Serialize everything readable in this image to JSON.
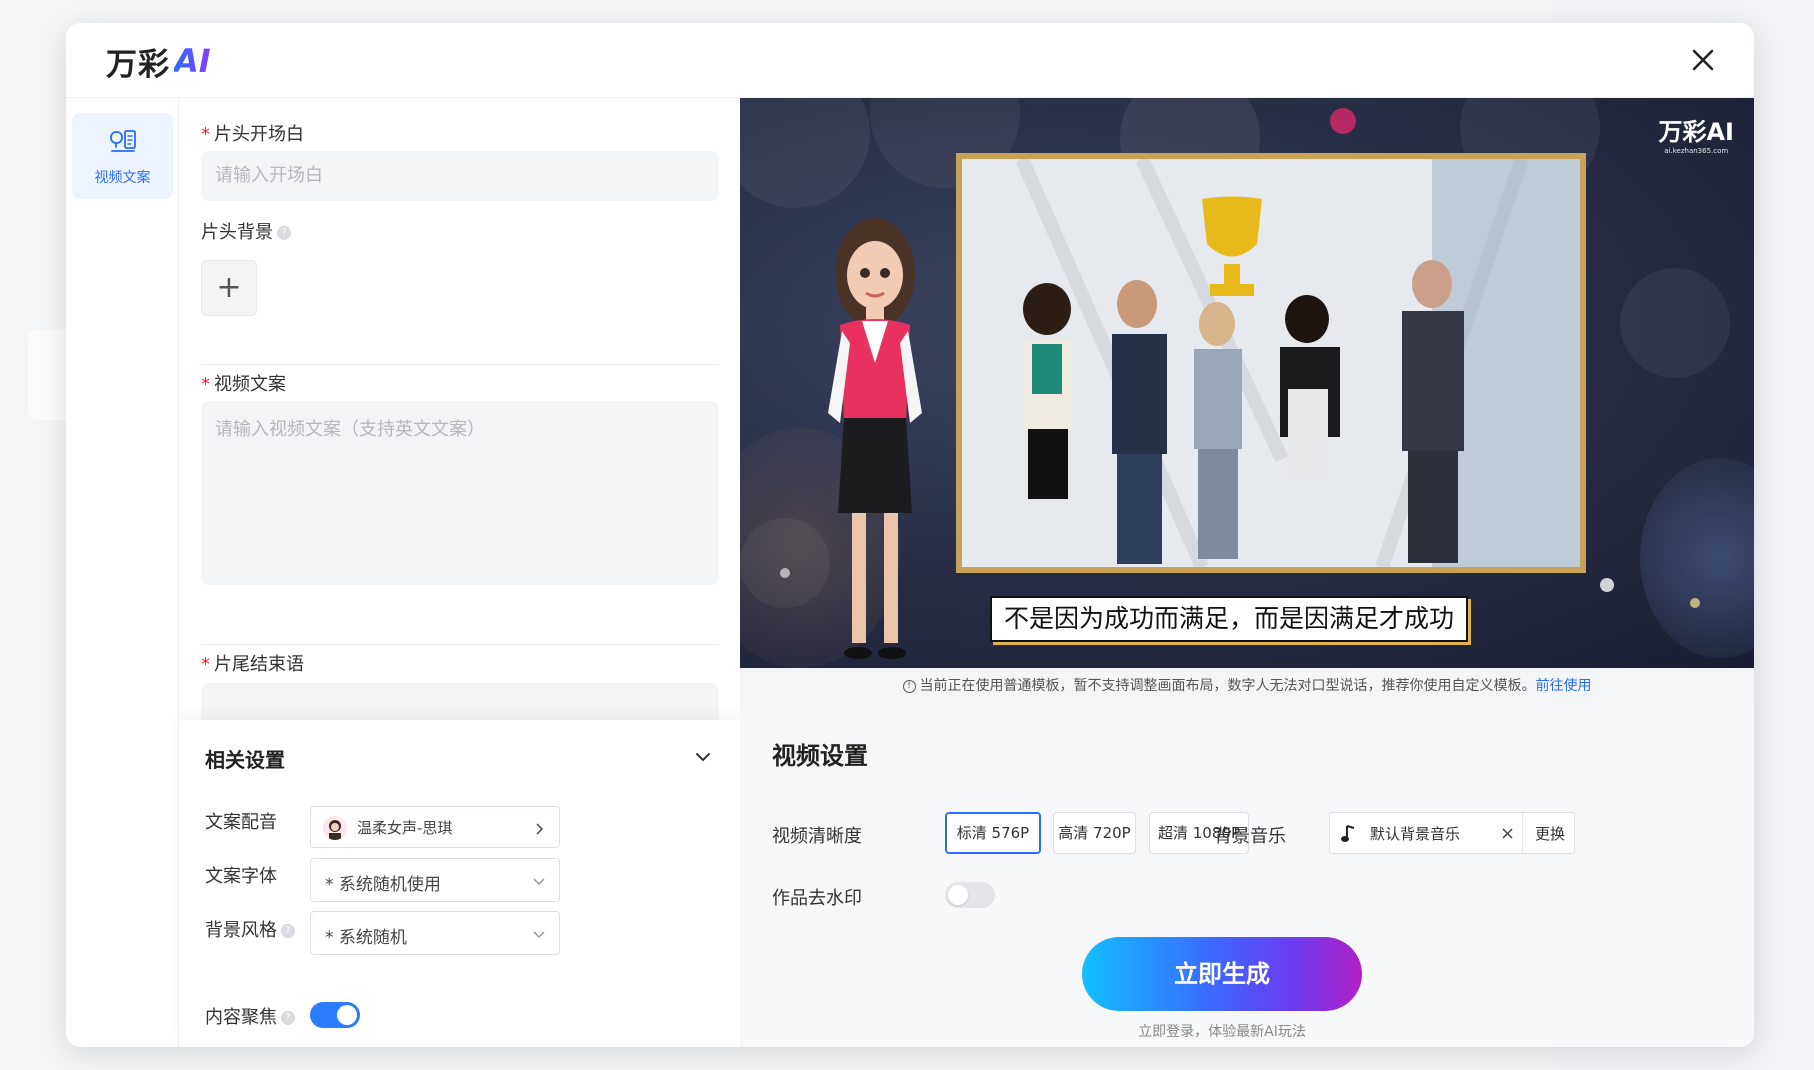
{
  "logo": {
    "text": "万彩",
    "ai": "AI"
  },
  "rail": {
    "item_label": "视频文案"
  },
  "form": {
    "opening": {
      "label": "片头开场白",
      "placeholder": "请输入开场白"
    },
    "opening_bg": {
      "label": "片头背景",
      "add_symbol": "+"
    },
    "script": {
      "label": "视频文案",
      "placeholder": "请输入视频文案（支持英文文案）"
    },
    "ending": {
      "label": "片尾结束语"
    }
  },
  "settings": {
    "title": "相关设置",
    "voice": {
      "label": "文案配音",
      "value": "温柔女声-思琪"
    },
    "font": {
      "label": "文案字体",
      "value": "* 系统随机使用"
    },
    "style": {
      "label": "背景风格",
      "value": "* 系统随机"
    },
    "focus": {
      "label": "内容聚焦",
      "on": true
    }
  },
  "preview": {
    "subtitle": "不是因为成功而满足，而是因满足才成功",
    "watermark": "万彩AI",
    "watermark_sub": "ai.kezhan365.com"
  },
  "notice": {
    "text": "当前正在使用普通模板，暂不支持调整画面布局，数字人无法对口型说话，推荐你使用自定义模板。",
    "link": "前往使用"
  },
  "video_settings": {
    "title": "视频设置",
    "resolution_label": "视频清晰度",
    "resolutions": [
      "标清 576P",
      "高清 720P",
      "超清 1080P"
    ],
    "selected_resolution": "标清 576P",
    "music_label": "背景音乐",
    "music_value": "默认背景音乐",
    "music_replace": "更换",
    "watermark_label": "作品去水印",
    "watermark_on": false,
    "generate_label": "立即生成",
    "login_hint": "立即登录，体验最新AI玩法"
  },
  "colors": {
    "accent": "#2b6cff",
    "required": "#f5222d",
    "frame_gold": "#c9a258",
    "button_gradient_start": "#12c0ff",
    "button_gradient_end": "#b21fc4"
  }
}
